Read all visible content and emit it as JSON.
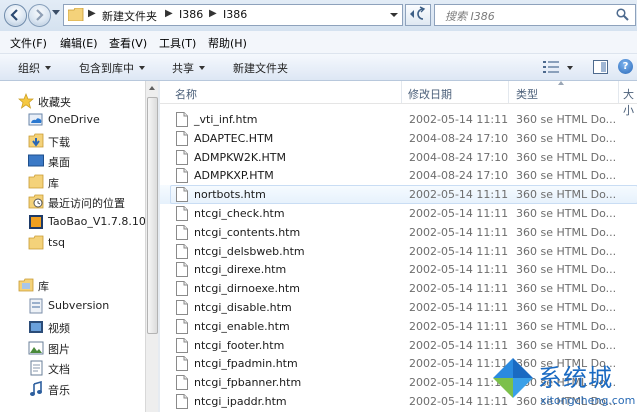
{
  "address": {
    "crumbs": [
      "新建文件夹",
      "I386",
      "I386"
    ],
    "search_placeholder": "搜索 I386"
  },
  "menu": [
    "文件(F)",
    "编辑(E)",
    "查看(V)",
    "工具(T)",
    "帮助(H)"
  ],
  "toolbar": {
    "organize": "组织",
    "include_in_library": "包含到库中",
    "share": "共享",
    "new_folder": "新建文件夹",
    "help_glyph": "?"
  },
  "nav": {
    "favorites": {
      "title": "收藏夹",
      "items": [
        "OneDrive",
        "下载",
        "桌面",
        "库",
        "最近访问的位置",
        "TaoBao_V1.7.8.10_",
        "tsq"
      ]
    },
    "libraries": {
      "title": "库",
      "items": [
        "Subversion",
        "视频",
        "图片",
        "文档",
        "音乐"
      ]
    }
  },
  "columns": {
    "name": "名称",
    "date": "修改日期",
    "type": "类型",
    "size": "大小"
  },
  "files": [
    {
      "name": "_vti_inf.htm",
      "date": "2002-05-14 11:11",
      "type": "360 se HTML Do..."
    },
    {
      "name": "ADAPTEC.HTM",
      "date": "2004-08-24 17:10",
      "type": "360 se HTML Do..."
    },
    {
      "name": "ADMPKW2K.HTM",
      "date": "2004-08-24 17:10",
      "type": "360 se HTML Do..."
    },
    {
      "name": "ADMPKXP.HTM",
      "date": "2004-08-24 17:10",
      "type": "360 se HTML Do..."
    },
    {
      "name": "nortbots.htm",
      "date": "2002-05-14 11:11",
      "type": "360 se HTML Do..."
    },
    {
      "name": "ntcgi_check.htm",
      "date": "2002-05-14 11:11",
      "type": "360 se HTML Do..."
    },
    {
      "name": "ntcgi_contents.htm",
      "date": "2002-05-14 11:11",
      "type": "360 se HTML Do..."
    },
    {
      "name": "ntcgi_delsbweb.htm",
      "date": "2002-05-14 11:11",
      "type": "360 se HTML Do..."
    },
    {
      "name": "ntcgi_direxe.htm",
      "date": "2002-05-14 11:11",
      "type": "360 se HTML Do..."
    },
    {
      "name": "ntcgi_dirnoexe.htm",
      "date": "2002-05-14 11:11",
      "type": "360 se HTML Do..."
    },
    {
      "name": "ntcgi_disable.htm",
      "date": "2002-05-14 11:11",
      "type": "360 se HTML Do..."
    },
    {
      "name": "ntcgi_enable.htm",
      "date": "2002-05-14 11:11",
      "type": "360 se HTML Do..."
    },
    {
      "name": "ntcgi_footer.htm",
      "date": "2002-05-14 11:11",
      "type": "360 se HTML Do..."
    },
    {
      "name": "ntcgi_fpadmin.htm",
      "date": "2002-05-14 11:11",
      "type": "360 se HTML Do..."
    },
    {
      "name": "ntcgi_fpbanner.htm",
      "date": "2002-05-14 11:11",
      "type": "360 se HTML Do..."
    },
    {
      "name": "ntcgi_ipaddr.htm",
      "date": "2002-05-14 11:11",
      "type": "360 se HTML Do..."
    }
  ],
  "hovered_file_index": 4,
  "watermark": {
    "text": "系统城",
    "url": "xitongcheng.com"
  }
}
